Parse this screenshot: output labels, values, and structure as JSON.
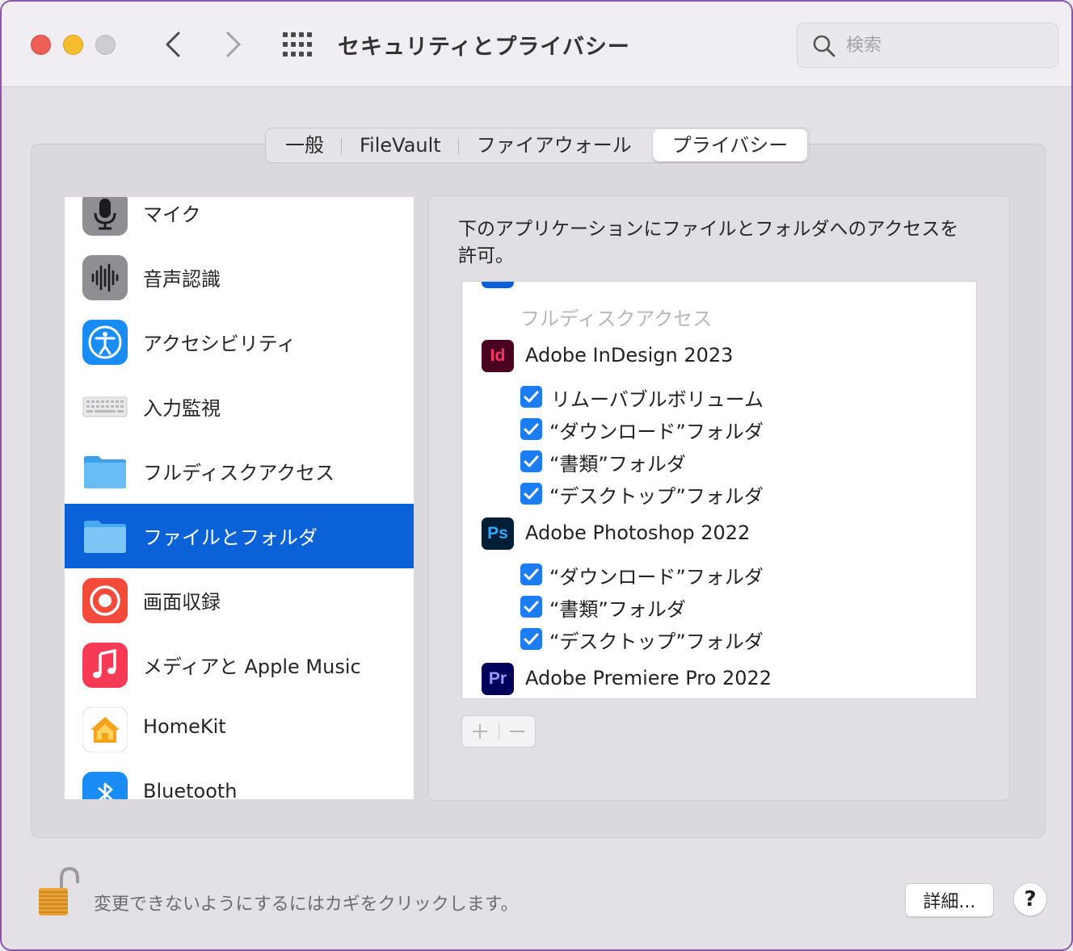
{
  "window": {
    "title": "セキュリティとプライバシー"
  },
  "search": {
    "placeholder": "検索"
  },
  "tabs": [
    {
      "label": "一般"
    },
    {
      "label": "FileVault"
    },
    {
      "label": "ファイアウォール"
    },
    {
      "label": "プライバシー",
      "active": true
    }
  ],
  "categories": [
    {
      "label": "マイク",
      "icon": "microphone-icon"
    },
    {
      "label": "音声認識",
      "icon": "waveform-icon"
    },
    {
      "label": "アクセシビリティ",
      "icon": "accessibility-icon"
    },
    {
      "label": "入力監視",
      "icon": "keyboard-icon"
    },
    {
      "label": "フルディスクアクセス",
      "icon": "folder-icon"
    },
    {
      "label": "ファイルとフォルダ",
      "icon": "folder-icon",
      "selected": true
    },
    {
      "label": "画面収録",
      "icon": "screen-record-icon"
    },
    {
      "label": "メディアと Apple Music",
      "icon": "music-note-icon"
    },
    {
      "label": "HomeKit",
      "icon": "home-icon"
    },
    {
      "label": "Bluetooth",
      "icon": "bluetooth-icon"
    }
  ],
  "description": "下のアプリケーションにファイルとフォルダへのアクセスを許可。",
  "app_list": {
    "ghost_label": "フルディスクアクセス",
    "apps": [
      {
        "name": "Adobe InDesign 2023",
        "badge": "Id",
        "badge_bg": "#49021f",
        "badge_fg": "#ff3366",
        "items": [
          "リムーバブルボリューム",
          "“ダウンロード”フォルダ",
          "“書類”フォルダ",
          "“デスクトップ”フォルダ"
        ]
      },
      {
        "name": "Adobe Photoshop 2022",
        "badge": "Ps",
        "badge_bg": "#001e36",
        "badge_fg": "#31a8ff",
        "items": [
          "“ダウンロード”フォルダ",
          "“書類”フォルダ",
          "“デスクトップ”フォルダ"
        ]
      },
      {
        "name": "Adobe Premiere Pro 2022",
        "badge": "Pr",
        "badge_bg": "#00005b",
        "badge_fg": "#9999ff",
        "items": []
      }
    ]
  },
  "footer": {
    "lock_text": "変更できないようにするにはカギをクリックします。",
    "details_label": "詳細...",
    "help_label": "?"
  },
  "colors": {
    "accent": "#0b62d8",
    "checkbox": "#1b7cf4"
  }
}
